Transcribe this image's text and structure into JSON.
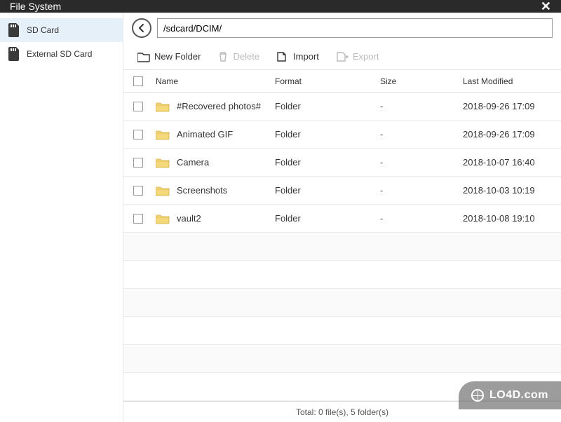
{
  "titlebar": {
    "title": "File System"
  },
  "sidebar": {
    "items": [
      {
        "label": "SD Card",
        "selected": true
      },
      {
        "label": "External SD Card",
        "selected": false
      }
    ]
  },
  "pathbar": {
    "path": "/sdcard/DCIM/"
  },
  "toolbar": {
    "new_folder": "New Folder",
    "delete": "Delete",
    "import": "Import",
    "export": "Export"
  },
  "table": {
    "headers": {
      "name": "Name",
      "format": "Format",
      "size": "Size",
      "modified": "Last Modified"
    },
    "rows": [
      {
        "name": "#Recovered photos#",
        "format": "Folder",
        "size": "-",
        "modified": "2018-09-26 17:09"
      },
      {
        "name": "Animated GIF",
        "format": "Folder",
        "size": "-",
        "modified": "2018-09-26 17:09"
      },
      {
        "name": "Camera",
        "format": "Folder",
        "size": "-",
        "modified": "2018-10-07 16:40"
      },
      {
        "name": "Screenshots",
        "format": "Folder",
        "size": "-",
        "modified": "2018-10-03 10:19"
      },
      {
        "name": "vault2",
        "format": "Folder",
        "size": "-",
        "modified": "2018-10-08 19:10"
      }
    ]
  },
  "statusbar": {
    "text": "Total: 0 file(s), 5 folder(s)"
  },
  "watermark": {
    "text": "LO4D.com"
  }
}
